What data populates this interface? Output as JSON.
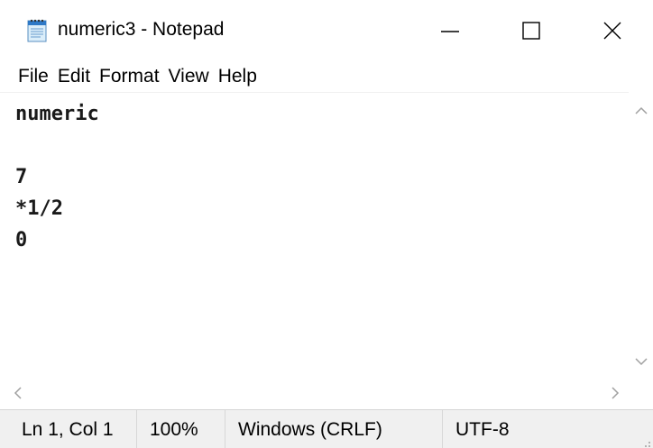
{
  "window": {
    "title": "numeric3 - Notepad",
    "app_icon": "notepad-icon",
    "controls": {
      "minimize": "minimize-icon",
      "maximize": "maximize-icon",
      "close": "close-icon"
    }
  },
  "menu": {
    "items": [
      {
        "label": "File"
      },
      {
        "label": "Edit"
      },
      {
        "label": "Format"
      },
      {
        "label": "View"
      },
      {
        "label": "Help"
      }
    ]
  },
  "editor": {
    "content": "numeric\n\n7\n*1/2\n0"
  },
  "statusbar": {
    "position": "Ln 1, Col 1",
    "zoom": "100%",
    "line_ending": "Windows (CRLF)",
    "encoding": "UTF-8"
  },
  "colors": {
    "statusbar_bg": "#f0f0f0",
    "scroll_arrow": "#a0a0a0",
    "text": "#000000"
  }
}
